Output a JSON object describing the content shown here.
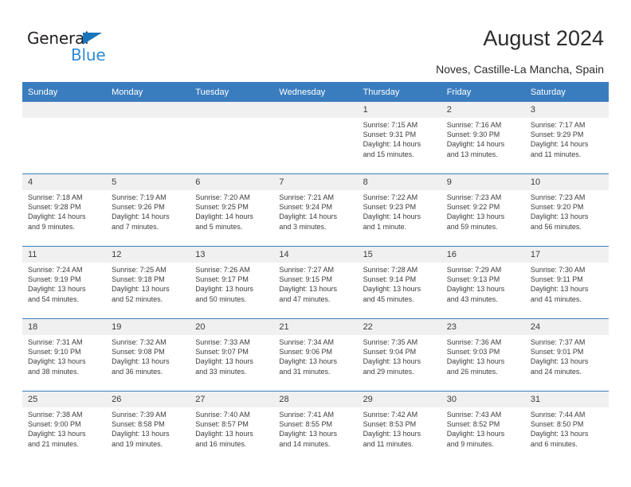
{
  "brand": {
    "name_top": "General",
    "name_bottom": "Blue",
    "triangle_color": "#1b75bb",
    "blue_color": "#2e8bd4"
  },
  "header": {
    "title": "August 2024",
    "location": "Noves, Castille-La Mancha, Spain",
    "header_bg": "#3a7dbf",
    "daynum_bg": "#f0f0f0"
  },
  "calendar": {
    "weekdays": [
      "Sunday",
      "Monday",
      "Tuesday",
      "Wednesday",
      "Thursday",
      "Friday",
      "Saturday"
    ],
    "weeks": [
      [
        {
          "day": "",
          "sunrise": "",
          "sunset": "",
          "daylight1": "",
          "daylight2": ""
        },
        {
          "day": "",
          "sunrise": "",
          "sunset": "",
          "daylight1": "",
          "daylight2": ""
        },
        {
          "day": "",
          "sunrise": "",
          "sunset": "",
          "daylight1": "",
          "daylight2": ""
        },
        {
          "day": "",
          "sunrise": "",
          "sunset": "",
          "daylight1": "",
          "daylight2": ""
        },
        {
          "day": "1",
          "sunrise": "Sunrise: 7:15 AM",
          "sunset": "Sunset: 9:31 PM",
          "daylight1": "Daylight: 14 hours",
          "daylight2": "and 15 minutes."
        },
        {
          "day": "2",
          "sunrise": "Sunrise: 7:16 AM",
          "sunset": "Sunset: 9:30 PM",
          "daylight1": "Daylight: 14 hours",
          "daylight2": "and 13 minutes."
        },
        {
          "day": "3",
          "sunrise": "Sunrise: 7:17 AM",
          "sunset": "Sunset: 9:29 PM",
          "daylight1": "Daylight: 14 hours",
          "daylight2": "and 11 minutes."
        }
      ],
      [
        {
          "day": "4",
          "sunrise": "Sunrise: 7:18 AM",
          "sunset": "Sunset: 9:28 PM",
          "daylight1": "Daylight: 14 hours",
          "daylight2": "and 9 minutes."
        },
        {
          "day": "5",
          "sunrise": "Sunrise: 7:19 AM",
          "sunset": "Sunset: 9:26 PM",
          "daylight1": "Daylight: 14 hours",
          "daylight2": "and 7 minutes."
        },
        {
          "day": "6",
          "sunrise": "Sunrise: 7:20 AM",
          "sunset": "Sunset: 9:25 PM",
          "daylight1": "Daylight: 14 hours",
          "daylight2": "and 5 minutes."
        },
        {
          "day": "7",
          "sunrise": "Sunrise: 7:21 AM",
          "sunset": "Sunset: 9:24 PM",
          "daylight1": "Daylight: 14 hours",
          "daylight2": "and 3 minutes."
        },
        {
          "day": "8",
          "sunrise": "Sunrise: 7:22 AM",
          "sunset": "Sunset: 9:23 PM",
          "daylight1": "Daylight: 14 hours",
          "daylight2": "and 1 minute."
        },
        {
          "day": "9",
          "sunrise": "Sunrise: 7:23 AM",
          "sunset": "Sunset: 9:22 PM",
          "daylight1": "Daylight: 13 hours",
          "daylight2": "and 59 minutes."
        },
        {
          "day": "10",
          "sunrise": "Sunrise: 7:23 AM",
          "sunset": "Sunset: 9:20 PM",
          "daylight1": "Daylight: 13 hours",
          "daylight2": "and 56 minutes."
        }
      ],
      [
        {
          "day": "11",
          "sunrise": "Sunrise: 7:24 AM",
          "sunset": "Sunset: 9:19 PM",
          "daylight1": "Daylight: 13 hours",
          "daylight2": "and 54 minutes."
        },
        {
          "day": "12",
          "sunrise": "Sunrise: 7:25 AM",
          "sunset": "Sunset: 9:18 PM",
          "daylight1": "Daylight: 13 hours",
          "daylight2": "and 52 minutes."
        },
        {
          "day": "13",
          "sunrise": "Sunrise: 7:26 AM",
          "sunset": "Sunset: 9:17 PM",
          "daylight1": "Daylight: 13 hours",
          "daylight2": "and 50 minutes."
        },
        {
          "day": "14",
          "sunrise": "Sunrise: 7:27 AM",
          "sunset": "Sunset: 9:15 PM",
          "daylight1": "Daylight: 13 hours",
          "daylight2": "and 47 minutes."
        },
        {
          "day": "15",
          "sunrise": "Sunrise: 7:28 AM",
          "sunset": "Sunset: 9:14 PM",
          "daylight1": "Daylight: 13 hours",
          "daylight2": "and 45 minutes."
        },
        {
          "day": "16",
          "sunrise": "Sunrise: 7:29 AM",
          "sunset": "Sunset: 9:13 PM",
          "daylight1": "Daylight: 13 hours",
          "daylight2": "and 43 minutes."
        },
        {
          "day": "17",
          "sunrise": "Sunrise: 7:30 AM",
          "sunset": "Sunset: 9:11 PM",
          "daylight1": "Daylight: 13 hours",
          "daylight2": "and 41 minutes."
        }
      ],
      [
        {
          "day": "18",
          "sunrise": "Sunrise: 7:31 AM",
          "sunset": "Sunset: 9:10 PM",
          "daylight1": "Daylight: 13 hours",
          "daylight2": "and 38 minutes."
        },
        {
          "day": "19",
          "sunrise": "Sunrise: 7:32 AM",
          "sunset": "Sunset: 9:08 PM",
          "daylight1": "Daylight: 13 hours",
          "daylight2": "and 36 minutes."
        },
        {
          "day": "20",
          "sunrise": "Sunrise: 7:33 AM",
          "sunset": "Sunset: 9:07 PM",
          "daylight1": "Daylight: 13 hours",
          "daylight2": "and 33 minutes."
        },
        {
          "day": "21",
          "sunrise": "Sunrise: 7:34 AM",
          "sunset": "Sunset: 9:06 PM",
          "daylight1": "Daylight: 13 hours",
          "daylight2": "and 31 minutes."
        },
        {
          "day": "22",
          "sunrise": "Sunrise: 7:35 AM",
          "sunset": "Sunset: 9:04 PM",
          "daylight1": "Daylight: 13 hours",
          "daylight2": "and 29 minutes."
        },
        {
          "day": "23",
          "sunrise": "Sunrise: 7:36 AM",
          "sunset": "Sunset: 9:03 PM",
          "daylight1": "Daylight: 13 hours",
          "daylight2": "and 26 minutes."
        },
        {
          "day": "24",
          "sunrise": "Sunrise: 7:37 AM",
          "sunset": "Sunset: 9:01 PM",
          "daylight1": "Daylight: 13 hours",
          "daylight2": "and 24 minutes."
        }
      ],
      [
        {
          "day": "25",
          "sunrise": "Sunrise: 7:38 AM",
          "sunset": "Sunset: 9:00 PM",
          "daylight1": "Daylight: 13 hours",
          "daylight2": "and 21 minutes."
        },
        {
          "day": "26",
          "sunrise": "Sunrise: 7:39 AM",
          "sunset": "Sunset: 8:58 PM",
          "daylight1": "Daylight: 13 hours",
          "daylight2": "and 19 minutes."
        },
        {
          "day": "27",
          "sunrise": "Sunrise: 7:40 AM",
          "sunset": "Sunset: 8:57 PM",
          "daylight1": "Daylight: 13 hours",
          "daylight2": "and 16 minutes."
        },
        {
          "day": "28",
          "sunrise": "Sunrise: 7:41 AM",
          "sunset": "Sunset: 8:55 PM",
          "daylight1": "Daylight: 13 hours",
          "daylight2": "and 14 minutes."
        },
        {
          "day": "29",
          "sunrise": "Sunrise: 7:42 AM",
          "sunset": "Sunset: 8:53 PM",
          "daylight1": "Daylight: 13 hours",
          "daylight2": "and 11 minutes."
        },
        {
          "day": "30",
          "sunrise": "Sunrise: 7:43 AM",
          "sunset": "Sunset: 8:52 PM",
          "daylight1": "Daylight: 13 hours",
          "daylight2": "and 9 minutes."
        },
        {
          "day": "31",
          "sunrise": "Sunrise: 7:44 AM",
          "sunset": "Sunset: 8:50 PM",
          "daylight1": "Daylight: 13 hours",
          "daylight2": "and 6 minutes."
        }
      ]
    ]
  }
}
